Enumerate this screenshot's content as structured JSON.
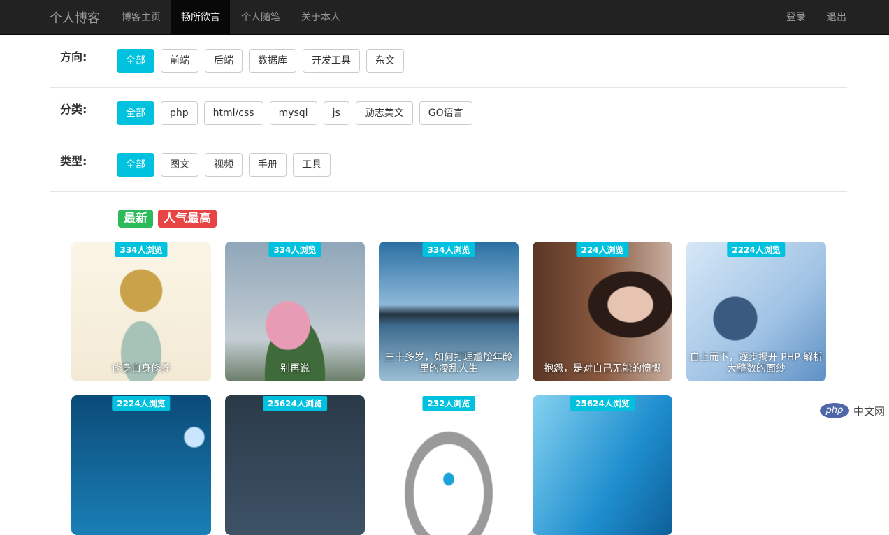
{
  "navbar": {
    "brand": "个人博客",
    "items": [
      "博客主页",
      "畅所欲言",
      "个人随笔",
      "关于本人"
    ],
    "active_index": 1,
    "login": "登录",
    "logout": "退出"
  },
  "filters": [
    {
      "label": "方向:",
      "options": [
        "全部",
        "前端",
        "后端",
        "数据库",
        "开发工具",
        "杂文"
      ]
    },
    {
      "label": "分类:",
      "options": [
        "全部",
        "php",
        "html/css",
        "mysql",
        "js",
        "励志美文",
        "GO语言"
      ]
    },
    {
      "label": "类型:",
      "options": [
        "全部",
        "图文",
        "视频",
        "手册",
        "工具"
      ]
    }
  ],
  "sort": {
    "newest": "最新",
    "popular": "人气最高"
  },
  "cards": [
    {
      "views": "334人浏览",
      "caption": "修身自身修养"
    },
    {
      "views": "334人浏览",
      "caption": "别再说"
    },
    {
      "views": "334人浏览",
      "caption": "三十多岁，如何打理尴尬年龄里的凌乱人生"
    },
    {
      "views": "224人浏览",
      "caption": "抱怨，是对自己无能的愤慨"
    },
    {
      "views": "2224人浏览",
      "caption": "自上而下，逐步揭开 PHP 解析大整数的面纱"
    },
    {
      "views": "2224人浏览",
      "caption": ""
    },
    {
      "views": "25624人浏览",
      "caption": ""
    },
    {
      "views": "232人浏览",
      "caption": ""
    },
    {
      "views": "25624人浏览",
      "caption": ""
    }
  ],
  "watermark": {
    "logo": "php",
    "text": "中文网"
  }
}
